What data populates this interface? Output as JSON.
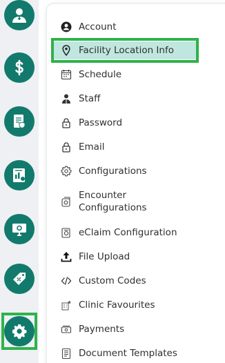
{
  "rail": {
    "items": [
      {
        "icon": "doctor-icon"
      },
      {
        "icon": "dollar-icon"
      },
      {
        "icon": "document-shield-icon"
      },
      {
        "icon": "report-chart-icon"
      },
      {
        "icon": "monitor-gear-icon"
      },
      {
        "icon": "tag-percent-icon"
      },
      {
        "icon": "gear-icon",
        "active": true
      }
    ],
    "color": "#127a6c",
    "highlight_color": "#2fb24a"
  },
  "menu": {
    "items": [
      {
        "label": "Account",
        "icon": "account-circle-icon"
      },
      {
        "label": "Facility Location Info",
        "icon": "location-pin-icon",
        "selected": true
      },
      {
        "label": "Schedule",
        "icon": "calendar-icon"
      },
      {
        "label": "Staff",
        "icon": "staff-icon"
      },
      {
        "label": "Password",
        "icon": "lock-icon"
      },
      {
        "label": "Email",
        "icon": "lock-icon"
      },
      {
        "label": "Configurations",
        "icon": "gear-icon"
      },
      {
        "label": "Encounter Configurations",
        "icon": "encounter-config-icon"
      },
      {
        "label": "eClaim Configuration",
        "icon": "eclaim-icon"
      },
      {
        "label": "File Upload",
        "icon": "upload-icon"
      },
      {
        "label": "Custom Codes",
        "icon": "code-icon"
      },
      {
        "label": "Clinic Favourites",
        "icon": "clinic-favourites-icon"
      },
      {
        "label": "Payments",
        "icon": "payments-icon"
      },
      {
        "label": "Document Templates",
        "icon": "document-template-icon"
      }
    ],
    "selected_bg": "#bfe7df"
  }
}
